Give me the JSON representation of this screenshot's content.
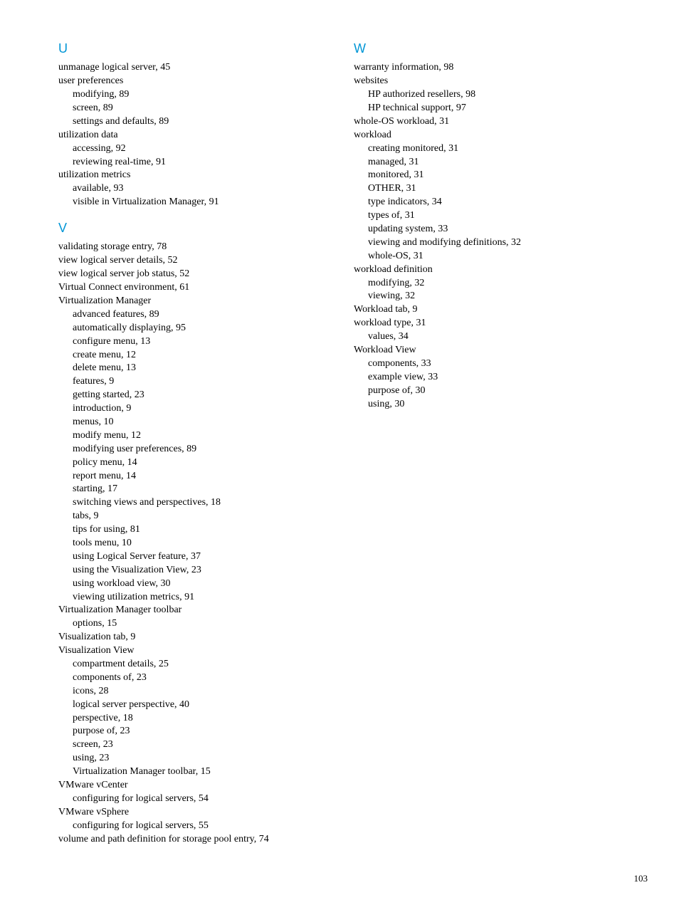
{
  "pageNumber": "103",
  "sections": {
    "u": {
      "letter": "U",
      "entries": [
        {
          "text": "unmanage logical server, 45"
        },
        {
          "text": "user preferences"
        },
        {
          "text": "modifying, 89",
          "sub": true
        },
        {
          "text": "screen, 89",
          "sub": true
        },
        {
          "text": "settings and defaults, 89",
          "sub": true
        },
        {
          "text": "utilization data"
        },
        {
          "text": "accessing, 92",
          "sub": true
        },
        {
          "text": "reviewing real-time, 91",
          "sub": true
        },
        {
          "text": "utilization metrics"
        },
        {
          "text": "available, 93",
          "sub": true
        },
        {
          "text": "visible in Virtualization Manager, 91",
          "sub": true
        }
      ]
    },
    "v": {
      "letter": "V",
      "entries": [
        {
          "text": "validating storage entry, 78"
        },
        {
          "text": "view logical server details, 52"
        },
        {
          "text": "view logical server job status, 52"
        },
        {
          "text": "Virtual Connect environment, 61"
        },
        {
          "text": "Virtualization Manager"
        },
        {
          "text": "advanced features, 89",
          "sub": true
        },
        {
          "text": "automatically displaying, 95",
          "sub": true
        },
        {
          "text": "configure menu, 13",
          "sub": true
        },
        {
          "text": "create menu, 12",
          "sub": true
        },
        {
          "text": "delete menu, 13",
          "sub": true
        },
        {
          "text": "features, 9",
          "sub": true
        },
        {
          "text": "getting started, 23",
          "sub": true
        },
        {
          "text": "introduction, 9",
          "sub": true
        },
        {
          "text": "menus, 10",
          "sub": true
        },
        {
          "text": "modify menu, 12",
          "sub": true
        },
        {
          "text": "modifying user preferences, 89",
          "sub": true
        },
        {
          "text": "policy menu, 14",
          "sub": true
        },
        {
          "text": "report menu, 14",
          "sub": true
        },
        {
          "text": "starting, 17",
          "sub": true
        },
        {
          "text": "switching views and perspectives, 18",
          "sub": true
        },
        {
          "text": "tabs, 9",
          "sub": true
        },
        {
          "text": "tips for using, 81",
          "sub": true
        },
        {
          "text": "tools menu, 10",
          "sub": true
        },
        {
          "text": "using Logical Server feature, 37",
          "sub": true
        },
        {
          "text": "using the Visualization View, 23",
          "sub": true
        },
        {
          "text": "using workload view, 30",
          "sub": true
        },
        {
          "text": "viewing utilization metrics, 91",
          "sub": true
        },
        {
          "text": "Virtualization Manager toolbar"
        },
        {
          "text": "options, 15",
          "sub": true
        },
        {
          "text": "Visualization tab, 9"
        },
        {
          "text": "Visualization View"
        },
        {
          "text": "compartment details, 25",
          "sub": true
        },
        {
          "text": "components of, 23",
          "sub": true
        },
        {
          "text": "icons, 28",
          "sub": true
        },
        {
          "text": "logical server perspective, 40",
          "sub": true
        },
        {
          "text": "perspective, 18",
          "sub": true
        },
        {
          "text": "purpose of, 23",
          "sub": true
        },
        {
          "text": "screen, 23",
          "sub": true
        },
        {
          "text": "using, 23",
          "sub": true
        },
        {
          "text": "Virtualization Manager toolbar, 15",
          "sub": true
        },
        {
          "text": "VMware vCenter"
        },
        {
          "text": "configuring for logical servers, 54",
          "sub": true
        },
        {
          "text": "VMware vSphere"
        },
        {
          "text": "configuring for logical servers, 55",
          "sub": true
        },
        {
          "text": "volume and path definition for storage pool entry, 74"
        }
      ]
    },
    "w": {
      "letter": "W",
      "entries": [
        {
          "text": "warranty information, 98"
        },
        {
          "text": "websites"
        },
        {
          "text": "HP authorized resellers, 98",
          "sub": true
        },
        {
          "text": "HP technical support, 97",
          "sub": true
        },
        {
          "text": "whole-OS workload, 31"
        },
        {
          "text": "workload"
        },
        {
          "text": "creating monitored, 31",
          "sub": true
        },
        {
          "text": "managed, 31",
          "sub": true
        },
        {
          "text": "monitored, 31",
          "sub": true
        },
        {
          "text": "OTHER, 31",
          "sub": true
        },
        {
          "text": "type indicators, 34",
          "sub": true
        },
        {
          "text": "types of, 31",
          "sub": true
        },
        {
          "text": "updating system, 33",
          "sub": true
        },
        {
          "text": "viewing and modifying definitions, 32",
          "sub": true
        },
        {
          "text": "whole-OS, 31",
          "sub": true
        },
        {
          "text": "workload definition"
        },
        {
          "text": "modifying, 32",
          "sub": true
        },
        {
          "text": "viewing, 32",
          "sub": true
        },
        {
          "text": "Workload tab, 9"
        },
        {
          "text": "workload type, 31"
        },
        {
          "text": "values, 34",
          "sub": true
        },
        {
          "text": "Workload View"
        },
        {
          "text": "components, 33",
          "sub": true
        },
        {
          "text": "example view, 33",
          "sub": true
        },
        {
          "text": "purpose of, 30",
          "sub": true
        },
        {
          "text": "using, 30",
          "sub": true
        }
      ]
    }
  }
}
